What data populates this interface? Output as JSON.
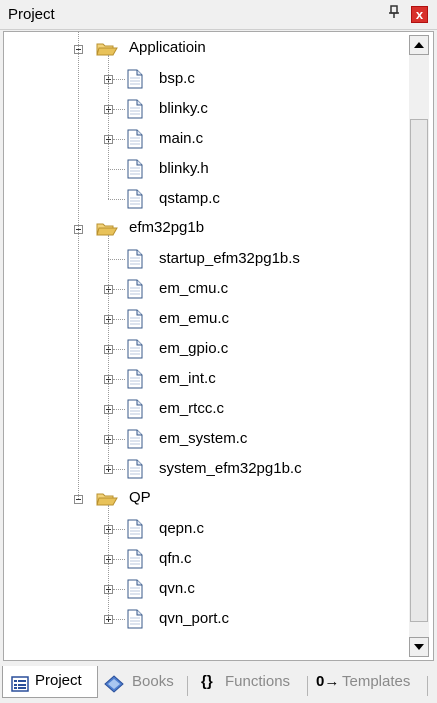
{
  "panel": {
    "title": "Project",
    "pin_glyph": "▇",
    "close_glyph": "x"
  },
  "tree": {
    "groups": [
      {
        "label": "Applicatioin",
        "icon": "folder-open-icon",
        "files": [
          {
            "name": "bsp.c",
            "expandable": true
          },
          {
            "name": "blinky.c",
            "expandable": true
          },
          {
            "name": "main.c",
            "expandable": true
          },
          {
            "name": "blinky.h",
            "expandable": false
          },
          {
            "name": "qstamp.c",
            "expandable": false
          }
        ]
      },
      {
        "label": "efm32pg1b",
        "icon": "folder-open-icon",
        "files": [
          {
            "name": "startup_efm32pg1b.s",
            "expandable": false
          },
          {
            "name": "em_cmu.c",
            "expandable": true
          },
          {
            "name": "em_emu.c",
            "expandable": true
          },
          {
            "name": "em_gpio.c",
            "expandable": true
          },
          {
            "name": "em_int.c",
            "expandable": true
          },
          {
            "name": "em_rtcc.c",
            "expandable": true
          },
          {
            "name": "em_system.c",
            "expandable": true
          },
          {
            "name": "system_efm32pg1b.c",
            "expandable": true
          }
        ]
      },
      {
        "label": "QP",
        "icon": "folder-open-icon",
        "files": [
          {
            "name": "qepn.c",
            "expandable": true
          },
          {
            "name": "qfn.c",
            "expandable": true
          },
          {
            "name": "qvn.c",
            "expandable": true
          },
          {
            "name": "qvn_port.c",
            "expandable": true
          }
        ]
      }
    ]
  },
  "tabs": [
    {
      "label": "Project",
      "active": true,
      "icon": "project-icon"
    },
    {
      "label": "Books",
      "active": false,
      "icon": "books-icon"
    },
    {
      "label": "Functions",
      "active": false,
      "icon": "functions-icon",
      "glyph": "{}"
    },
    {
      "label": "Templates",
      "active": false,
      "icon": "templates-icon",
      "glyph": "0→"
    }
  ],
  "colors": {
    "folder": "#e8c25a",
    "close": "#d8302b",
    "tab_inactive_text": "#8a8a8a"
  }
}
